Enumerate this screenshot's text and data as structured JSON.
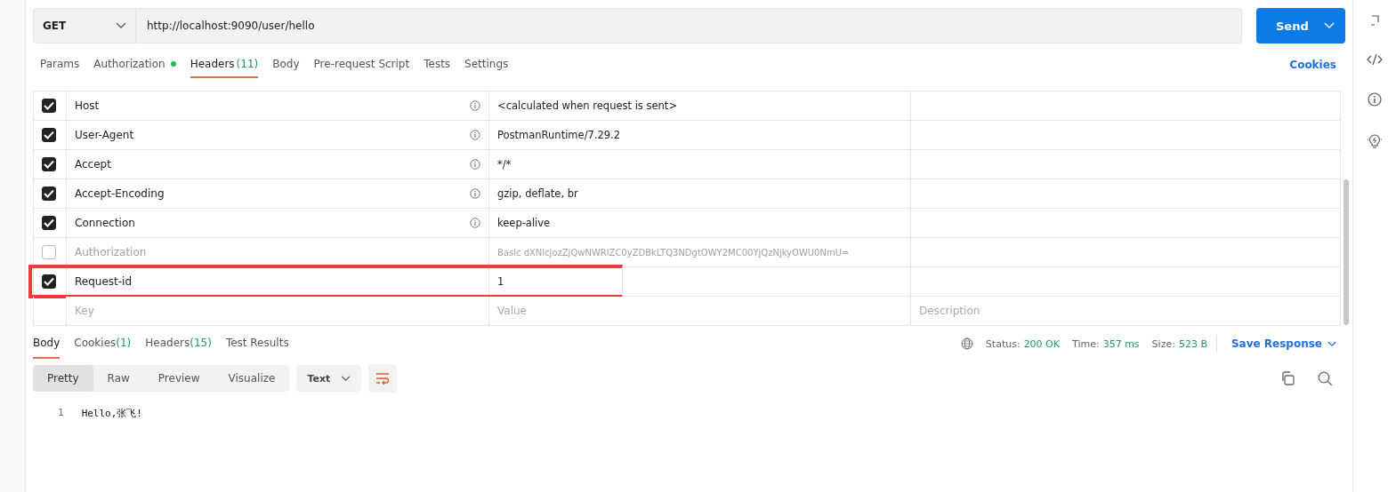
{
  "request": {
    "method": "GET",
    "url": "http://localhost:9090/user/hello",
    "send_label": "Send"
  },
  "request_tabs": [
    {
      "label": "Params",
      "dot": false,
      "selected": false
    },
    {
      "label": "Authorization",
      "dot": true,
      "selected": false
    },
    {
      "label": "Headers",
      "count": "(11)",
      "dot": false,
      "selected": true
    },
    {
      "label": "Body",
      "dot": false,
      "selected": false
    },
    {
      "label": "Pre-request Script",
      "dot": false,
      "selected": false
    },
    {
      "label": "Tests",
      "dot": false,
      "selected": false
    },
    {
      "label": "Settings",
      "dot": false,
      "selected": false
    }
  ],
  "cookies_link": "Cookies",
  "headers": {
    "rows": [
      {
        "checked": true,
        "key": "Host",
        "value": "<calculated when request is sent>",
        "info": true,
        "highlighted": false
      },
      {
        "checked": true,
        "key": "User-Agent",
        "value": "PostmanRuntime/7.29.2",
        "info": true,
        "highlighted": false
      },
      {
        "checked": true,
        "key": "Accept",
        "value": "*/*",
        "info": true,
        "highlighted": false
      },
      {
        "checked": true,
        "key": "Accept-Encoding",
        "value": "gzip, deflate, br",
        "info": true,
        "highlighted": false
      },
      {
        "checked": true,
        "key": "Connection",
        "value": "keep-alive",
        "info": true,
        "highlighted": false
      },
      {
        "checked": false,
        "key": "Authorization",
        "value": "Basic dXNlcjozZjQwNWRlZC0yZDBkLTQ3NDgtOWY2MC00YjQzNjkyOWU0NmU=",
        "info": false,
        "highlighted": false
      },
      {
        "checked": true,
        "key": "Request-id",
        "value": "1",
        "info": false,
        "highlighted": true
      }
    ],
    "new_row": {
      "key": {
        "placeholder": "Key"
      },
      "value": {
        "placeholder": "Value"
      },
      "description": {
        "placeholder": "Description"
      }
    }
  },
  "response": {
    "tabs": [
      {
        "label": "Body",
        "selected": true
      },
      {
        "label": "Cookies",
        "count": "(1)",
        "selected": false
      },
      {
        "label": "Headers",
        "count": "(15)",
        "selected": false
      },
      {
        "label": "Test Results",
        "selected": false
      }
    ],
    "meta": [
      {
        "label": "Status:",
        "value": "200 OK"
      },
      {
        "label": "Time:",
        "value": "357 ms"
      },
      {
        "label": "Size:",
        "value": "523 B"
      }
    ],
    "save_label": "Save Response",
    "views": [
      {
        "label": "Pretty",
        "selected": true
      },
      {
        "label": "Raw",
        "selected": false
      },
      {
        "label": "Preview",
        "selected": false
      },
      {
        "label": "Visualize",
        "selected": false
      }
    ],
    "format": "Text",
    "lines": [
      {
        "number": "1",
        "text": "Hello,张飞!"
      }
    ]
  }
}
